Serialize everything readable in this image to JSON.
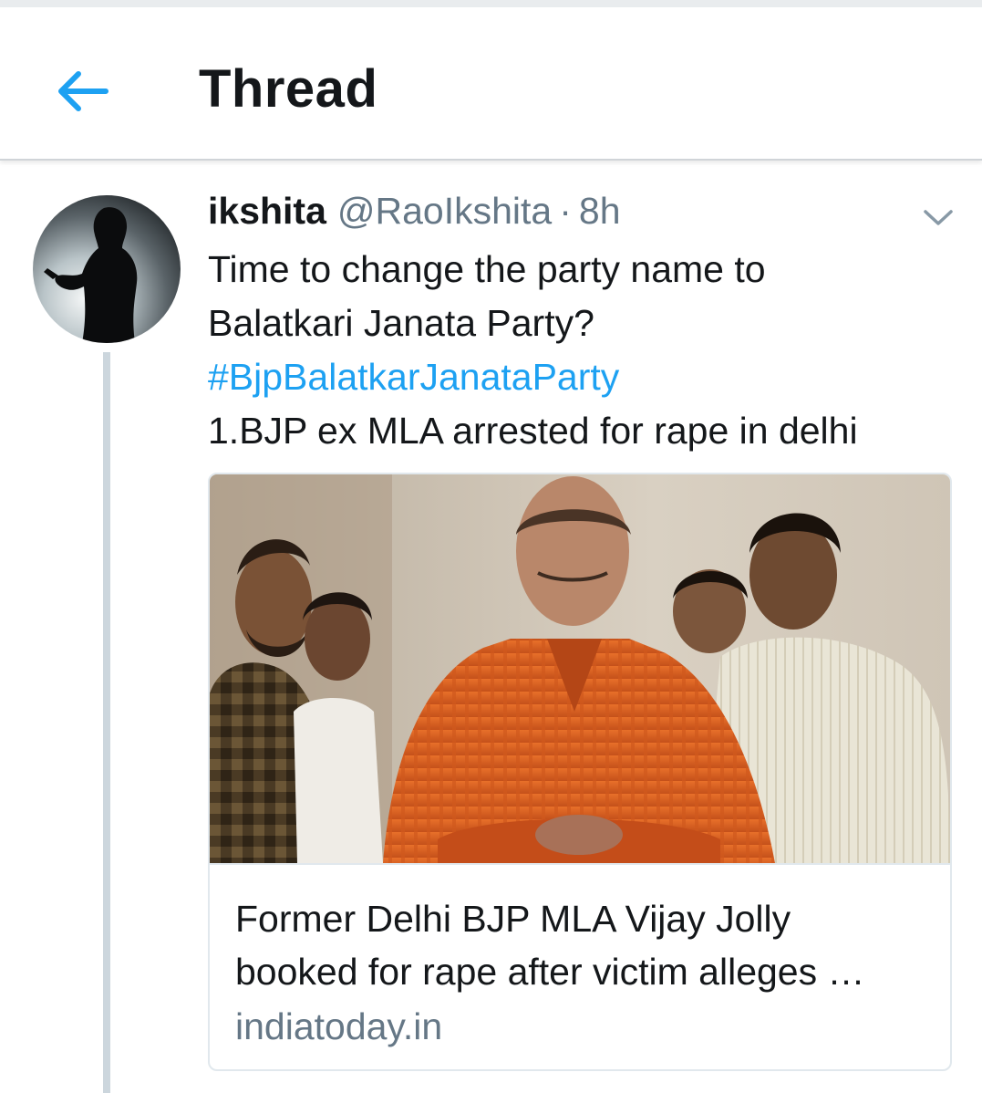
{
  "header": {
    "title": "Thread",
    "back_icon": "arrow-left-icon",
    "accent": "#1da1f2"
  },
  "tweet": {
    "display_name": "ikshita",
    "handle": "@RaoIkshita",
    "separator": "·",
    "time": "8h",
    "text_line_1": "Time to change the party name to",
    "text_line_2": "Balatkari Janata Party?",
    "hashtag": "#BjpBalatkarJanataParty",
    "text_line_4": "1.BJP ex MLA arrested for rape in delhi",
    "caret_icon": "chevron-down-icon"
  },
  "card": {
    "title_line_1": "Former Delhi BJP MLA Vijay Jolly",
    "title_line_2": "booked for rape after victim alleges …",
    "domain": "indiatoday.in"
  },
  "colors": {
    "text": "#14171a",
    "secondary": "#657786",
    "link": "#1da1f2",
    "thread_line": "#ccd6dd",
    "border": "#e1e8ed"
  }
}
